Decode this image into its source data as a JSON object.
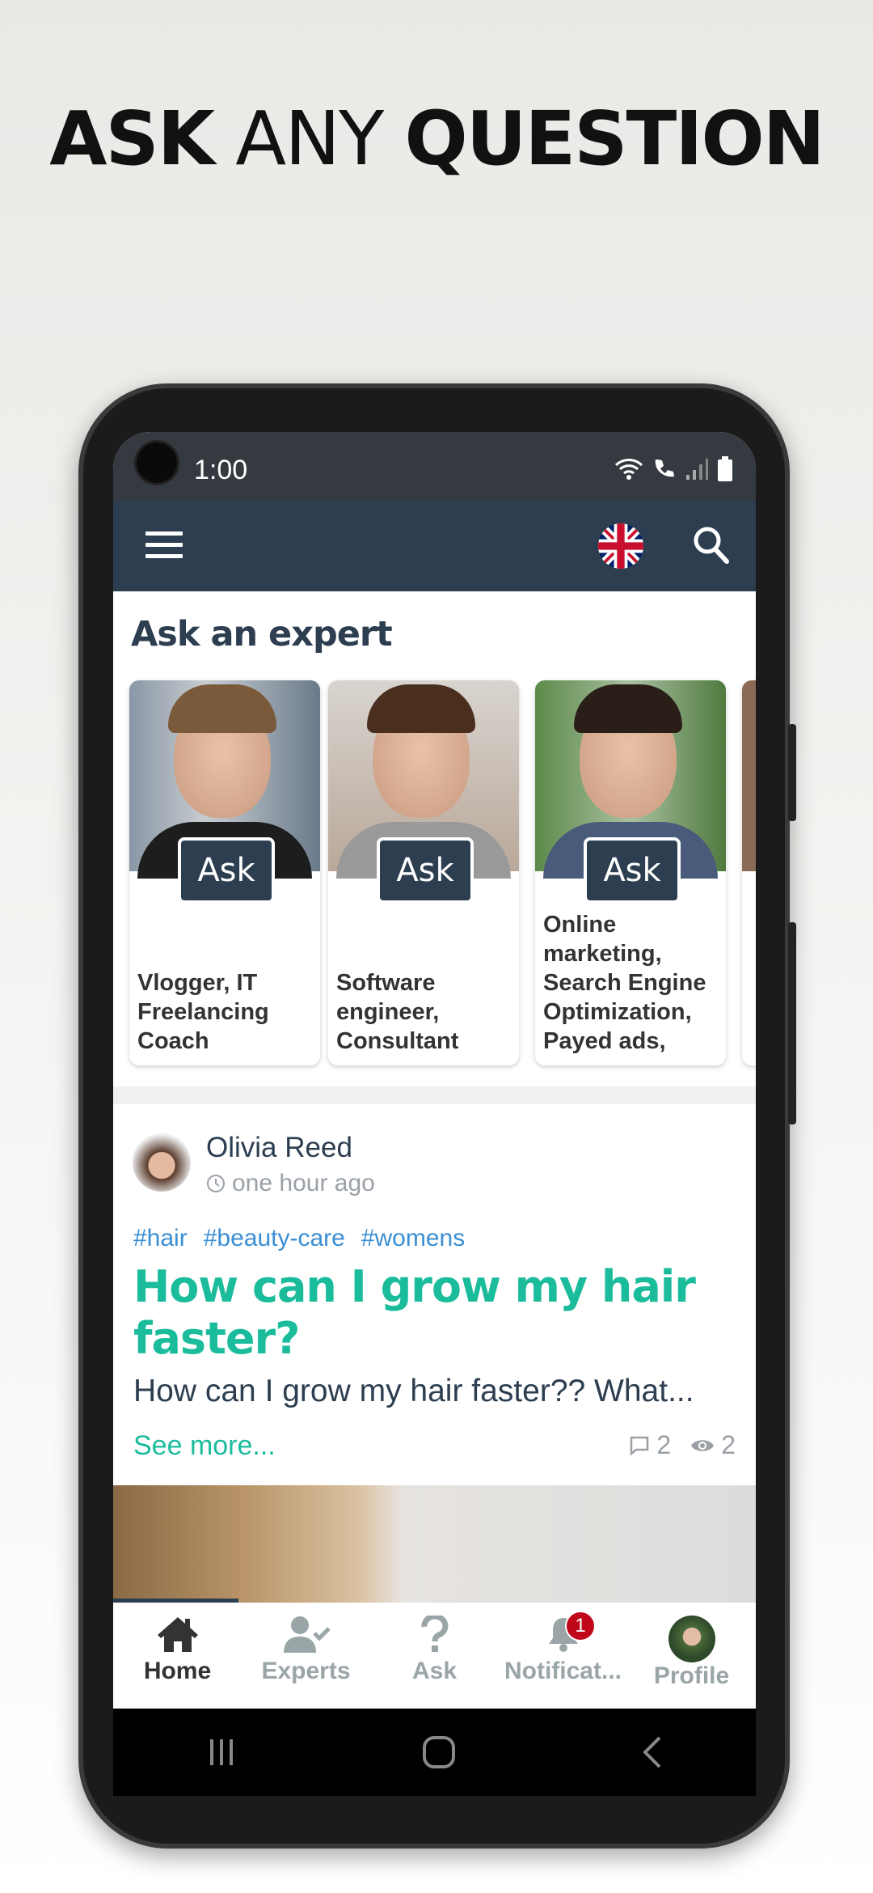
{
  "headline": {
    "bold1": "ASK",
    "light": "ANY",
    "bold2": "QUESTION"
  },
  "status_bar": {
    "time": "1:00",
    "sim": "1"
  },
  "app_bar": {
    "menu_icon": "hamburger-icon",
    "language_icon": "uk-flag-icon",
    "search_icon": "search-icon",
    "color": "#2c3e50"
  },
  "experts": {
    "title": "Ask an expert",
    "ask_label": "Ask",
    "cards": [
      {
        "description": "Vlogger, IT Freelancing Coach"
      },
      {
        "description": "Software engineer, Consultant"
      },
      {
        "description": "Online marketing, Search Engine Optimization, Payed ads,"
      }
    ]
  },
  "post": {
    "author": "Olivia Reed",
    "time": "one hour ago",
    "tags": [
      "#hair",
      "#beauty-care",
      "#womens"
    ],
    "title": "How can I grow my hair faster?",
    "excerpt": "How can I grow my hair faster?? What...",
    "see_more": "See more...",
    "comments": "2",
    "views": "2",
    "accent": "#1abc9c",
    "tag_color": "#3a8ed4"
  },
  "bottom_nav": {
    "items": [
      {
        "label": "Home",
        "icon": "home-icon",
        "active": true
      },
      {
        "label": "Experts",
        "icon": "user-check-icon"
      },
      {
        "label": "Ask",
        "icon": "question-icon"
      },
      {
        "label": "Notificat...",
        "icon": "bell-icon",
        "badge": "1"
      },
      {
        "label": "Profile",
        "icon": "avatar"
      }
    ]
  }
}
